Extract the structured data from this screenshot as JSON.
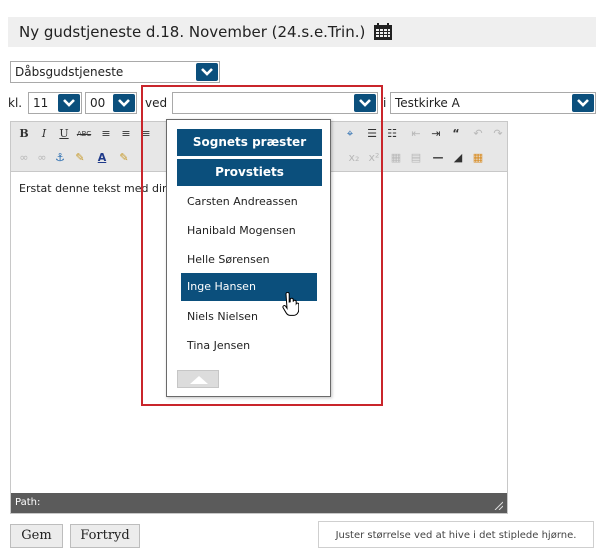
{
  "header": {
    "title": "Ny gudstjeneste d.18. November (24.s.e.Trin.)",
    "icon": "calendar-icon"
  },
  "service_type": {
    "value": "Dåbsgudstjeneste"
  },
  "time": {
    "kl_label": "kl.",
    "hour": "11",
    "minute": "00"
  },
  "ved": {
    "label": "ved",
    "value": ""
  },
  "church": {
    "label": "i",
    "value": "Testkirke A"
  },
  "dropdown": {
    "heading_1": "Sognets præster",
    "heading_2": "Provstiets prædikanter",
    "items": [
      "Carsten Andreassen",
      "Hanibald Mogensen",
      "Helle Sørensen",
      "Inge Hansen",
      "Niels Nielsen",
      "Tina Jensen"
    ],
    "selected": "Inge Hansen"
  },
  "editor": {
    "content": "Erstat denne tekst med din",
    "path_label": "Path:"
  },
  "buttons": {
    "save": "Gem",
    "cancel": "Fortryd"
  },
  "resize_hint": "Juster størrelse ved at hive i det stiplede hjørne.",
  "colors": {
    "accent": "#0b4f7c",
    "highlight": "#c9252b",
    "path_bar": "#5b5b5b"
  }
}
